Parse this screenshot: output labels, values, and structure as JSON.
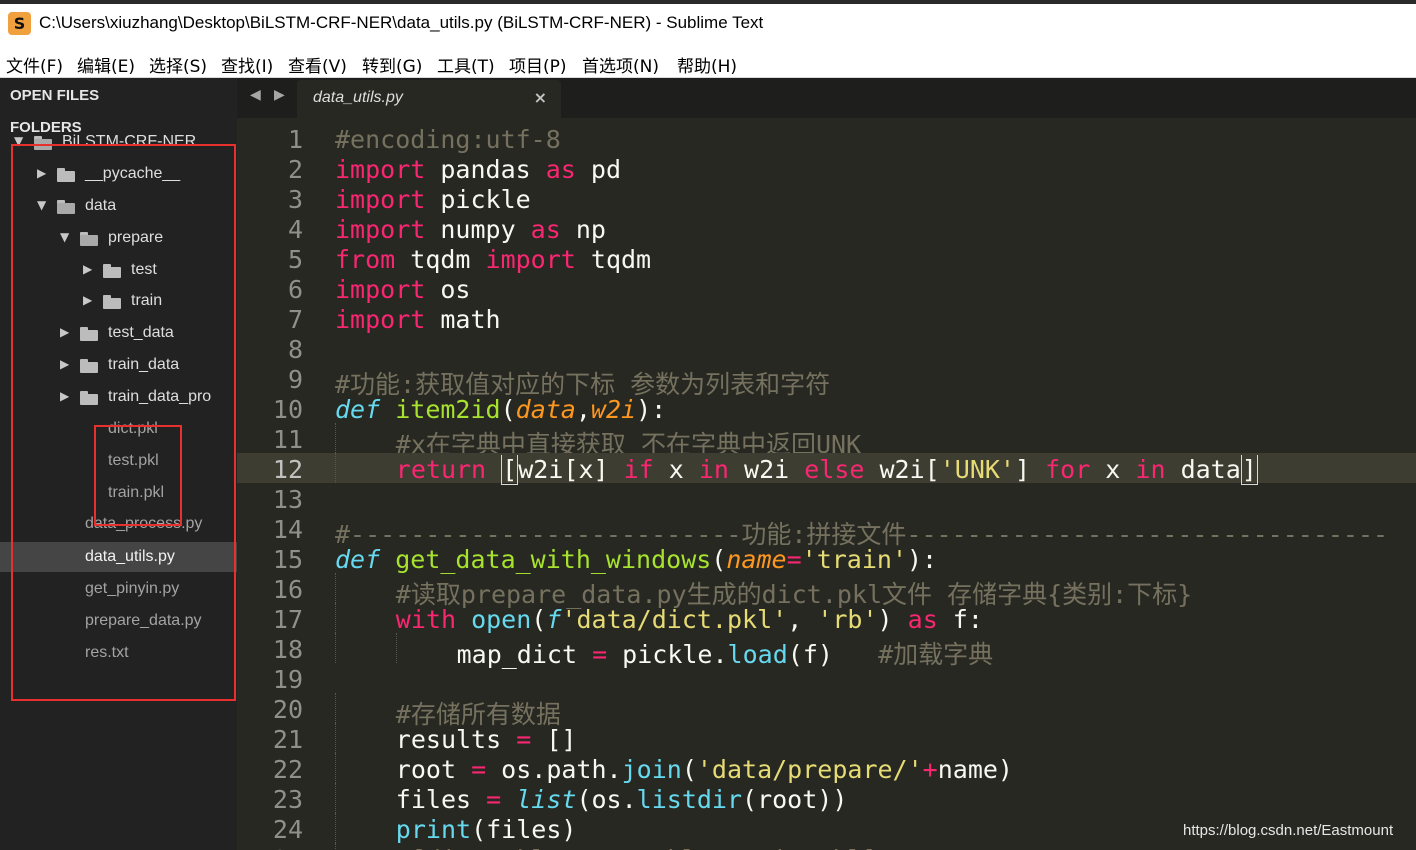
{
  "window": {
    "title": "C:\\Users\\xiuzhang\\Desktop\\BiLSTM-CRF-NER\\data_utils.py (BiLSTM-CRF-NER) - Sublime Text",
    "logo_glyph": "S"
  },
  "menu": [
    "文件(F)",
    "编辑(E)",
    "选择(S)",
    "查找(I)",
    "查看(V)",
    "转到(G)",
    "工具(T)",
    "项目(P)",
    "首选项(N)",
    "帮助(H)"
  ],
  "sidebar": {
    "open_files_label": "OPEN FILES",
    "folders_label": "FOLDERS",
    "tree": [
      {
        "label": "BiLSTM-CRF-NER",
        "type": "folder",
        "open": true,
        "depth": 0
      },
      {
        "label": "__pycache__",
        "type": "folder",
        "open": false,
        "depth": 1
      },
      {
        "label": "data",
        "type": "folder",
        "open": true,
        "depth": 1
      },
      {
        "label": "prepare",
        "type": "folder",
        "open": true,
        "depth": 2
      },
      {
        "label": "test",
        "type": "folder",
        "open": false,
        "depth": 3
      },
      {
        "label": "train",
        "type": "folder",
        "open": false,
        "depth": 3
      },
      {
        "label": "test_data",
        "type": "folder",
        "open": false,
        "depth": 2
      },
      {
        "label": "train_data",
        "type": "folder",
        "open": false,
        "depth": 2
      },
      {
        "label": "train_data_pro",
        "type": "folder",
        "open": false,
        "depth": 2
      },
      {
        "label": "dict.pkl",
        "type": "file",
        "depth": 2
      },
      {
        "label": "test.pkl",
        "type": "file",
        "depth": 2
      },
      {
        "label": "train.pkl",
        "type": "file",
        "depth": 2
      },
      {
        "label": "data_process.py",
        "type": "file",
        "depth": 1
      },
      {
        "label": "data_utils.py",
        "type": "file",
        "depth": 1,
        "selected": true
      },
      {
        "label": "get_pinyin.py",
        "type": "file",
        "depth": 1
      },
      {
        "label": "prepare_data.py",
        "type": "file",
        "depth": 1
      },
      {
        "label": "res.txt",
        "type": "file",
        "depth": 1
      }
    ]
  },
  "tabs": {
    "nav_left": "◀",
    "nav_right": "▶",
    "active_tab_label": "data_utils.py",
    "close_glyph": "×"
  },
  "editor": {
    "active_line": 12,
    "lines": [
      {
        "n": "1",
        "indent": 0,
        "tokens": [
          [
            "cm",
            "#encoding:utf-8"
          ]
        ]
      },
      {
        "n": "2",
        "indent": 0,
        "tokens": [
          [
            "kw",
            "import"
          ],
          [
            "",
            " pandas "
          ],
          [
            "kw",
            "as"
          ],
          [
            "",
            " pd"
          ]
        ]
      },
      {
        "n": "3",
        "indent": 0,
        "tokens": [
          [
            "kw",
            "import"
          ],
          [
            "",
            " pickle"
          ]
        ]
      },
      {
        "n": "4",
        "indent": 0,
        "tokens": [
          [
            "kw",
            "import"
          ],
          [
            "",
            " numpy "
          ],
          [
            "kw",
            "as"
          ],
          [
            "",
            " np"
          ]
        ]
      },
      {
        "n": "5",
        "indent": 0,
        "tokens": [
          [
            "kw",
            "from"
          ],
          [
            "",
            " tqdm "
          ],
          [
            "kw",
            "import"
          ],
          [
            "",
            " tqdm"
          ]
        ]
      },
      {
        "n": "6",
        "indent": 0,
        "tokens": [
          [
            "kw",
            "import"
          ],
          [
            "",
            " os"
          ]
        ]
      },
      {
        "n": "7",
        "indent": 0,
        "tokens": [
          [
            "kw",
            "import"
          ],
          [
            "",
            " math"
          ]
        ]
      },
      {
        "n": "8",
        "indent": 0,
        "tokens": []
      },
      {
        "n": "9",
        "indent": 0,
        "tokens": [
          [
            "cm",
            "#功能:获取值对应的下标 参数为列表和字符"
          ]
        ]
      },
      {
        "n": "10",
        "indent": 0,
        "tokens": [
          [
            "dk",
            "def"
          ],
          [
            "",
            " "
          ],
          [
            "fn",
            "item2id"
          ],
          [
            "",
            "("
          ],
          [
            "pa",
            "data"
          ],
          [
            "",
            ","
          ],
          [
            "pa",
            "w2i"
          ],
          [
            "",
            "):"
          ]
        ]
      },
      {
        "n": "11",
        "indent": 1,
        "tokens": [
          [
            "cm",
            "#x在字典中直接获取 不在字典中返回UNK"
          ]
        ]
      },
      {
        "n": "12",
        "indent": 1,
        "tokens": [
          [
            "kw",
            "return"
          ],
          [
            "",
            " "
          ],
          [
            "bk",
            "["
          ],
          [
            "",
            "w2i[x] "
          ],
          [
            "kw",
            "if"
          ],
          [
            "",
            " x "
          ],
          [
            "kw",
            "in"
          ],
          [
            "",
            " w2i "
          ],
          [
            "kw",
            "else"
          ],
          [
            "",
            " w2i["
          ],
          [
            "st",
            "'UNK'"
          ],
          [
            "",
            "] "
          ],
          [
            "kw",
            "for"
          ],
          [
            "",
            " x "
          ],
          [
            "kw",
            "in"
          ],
          [
            "",
            " data"
          ],
          [
            "bk",
            "]"
          ]
        ]
      },
      {
        "n": "13",
        "indent": 0,
        "tokens": []
      },
      {
        "n": "14",
        "indent": 0,
        "tokens": [
          [
            "cm",
            "#--------------------------功能:拼接文件--------------------------------"
          ]
        ]
      },
      {
        "n": "15",
        "indent": 0,
        "tokens": [
          [
            "dk",
            "def"
          ],
          [
            "",
            " "
          ],
          [
            "fn",
            "get_data_with_windows"
          ],
          [
            "",
            "("
          ],
          [
            "pa",
            "name"
          ],
          [
            "kw",
            "="
          ],
          [
            "st",
            "'train'"
          ],
          [
            "",
            "):"
          ]
        ]
      },
      {
        "n": "16",
        "indent": 1,
        "tokens": [
          [
            "cm",
            "#读取prepare_data.py生成的dict.pkl文件 存储字典{类别:下标}"
          ]
        ]
      },
      {
        "n": "17",
        "indent": 1,
        "tokens": [
          [
            "kw",
            "with"
          ],
          [
            "",
            " "
          ],
          [
            "bi",
            "open"
          ],
          [
            "",
            "("
          ],
          [
            "dk",
            "f"
          ],
          [
            "st",
            "'data/dict.pkl'"
          ],
          [
            "",
            ", "
          ],
          [
            "st",
            "'rb'"
          ],
          [
            "",
            ") "
          ],
          [
            "kw",
            "as"
          ],
          [
            "",
            " f:"
          ]
        ]
      },
      {
        "n": "18",
        "indent": 2,
        "tokens": [
          [
            "",
            "map_dict "
          ],
          [
            "kw",
            "="
          ],
          [
            "",
            " pickle."
          ],
          [
            "bi",
            "load"
          ],
          [
            "",
            "(f)   "
          ],
          [
            "cm",
            "#加载字典"
          ]
        ]
      },
      {
        "n": "19",
        "indent": 0,
        "tokens": []
      },
      {
        "n": "20",
        "indent": 1,
        "tokens": [
          [
            "cm",
            "#存储所有数据"
          ]
        ]
      },
      {
        "n": "21",
        "indent": 1,
        "tokens": [
          [
            "",
            "results "
          ],
          [
            "kw",
            "="
          ],
          [
            "",
            " []"
          ]
        ]
      },
      {
        "n": "22",
        "indent": 1,
        "tokens": [
          [
            "",
            "root "
          ],
          [
            "kw",
            "="
          ],
          [
            "",
            " os.path."
          ],
          [
            "bi",
            "join"
          ],
          [
            "",
            "("
          ],
          [
            "st",
            "'data/prepare/'"
          ],
          [
            "kw",
            "+"
          ],
          [
            "",
            "name)"
          ]
        ]
      },
      {
        "n": "23",
        "indent": 1,
        "tokens": [
          [
            "",
            "files "
          ],
          [
            "kw",
            "="
          ],
          [
            "",
            " "
          ],
          [
            "dk",
            "list"
          ],
          [
            "",
            "(os."
          ],
          [
            "bi",
            "listdir"
          ],
          [
            "",
            "(root))"
          ]
        ]
      },
      {
        "n": "24",
        "indent": 1,
        "tokens": [
          [
            "bi",
            "print"
          ],
          [
            "",
            "(files)"
          ]
        ]
      },
      {
        "n": "25",
        "indent": 1,
        "tokens": [
          [
            "cm",
            "#[dict.pkl, test.pkl, train.pkl]"
          ]
        ]
      }
    ]
  },
  "watermark": "https://blog.csdn.net/Eastmount"
}
